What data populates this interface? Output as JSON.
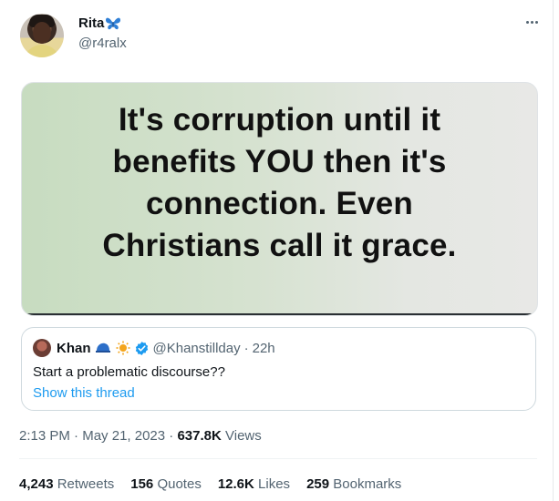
{
  "author": {
    "display_name": "Rita",
    "name_emoji": "butterfly-icon",
    "handle": "@r4ralx"
  },
  "media": {
    "lines": [
      "It's corruption until it",
      "benefits YOU then it's",
      "connection. Even",
      "Christians call it grace."
    ]
  },
  "quoted_tweet": {
    "display_name": "Khan",
    "badges": [
      "blue-cap-icon",
      "sun-icon",
      "verified-badge-icon"
    ],
    "handle": "@Khanstillday",
    "separator": "·",
    "time": "22h",
    "text": "Start a problematic discourse??",
    "thread_link": "Show this thread"
  },
  "meta": {
    "time": "2:13 PM",
    "sep1": "·",
    "date": "May 21, 2023",
    "sep2": "·",
    "views_count": "637.8K",
    "views_label": "Views"
  },
  "stats": {
    "retweets_count": "4,243",
    "retweets_label": "Retweets",
    "quotes_count": "156",
    "quotes_label": "Quotes",
    "likes_count": "12.6K",
    "likes_label": "Likes",
    "bookmarks_count": "259",
    "bookmarks_label": "Bookmarks"
  },
  "colors": {
    "link": "#1d9bf0",
    "secondary_text": "#536471",
    "primary_text": "#0f1419",
    "verified": "#1d9bf0"
  }
}
